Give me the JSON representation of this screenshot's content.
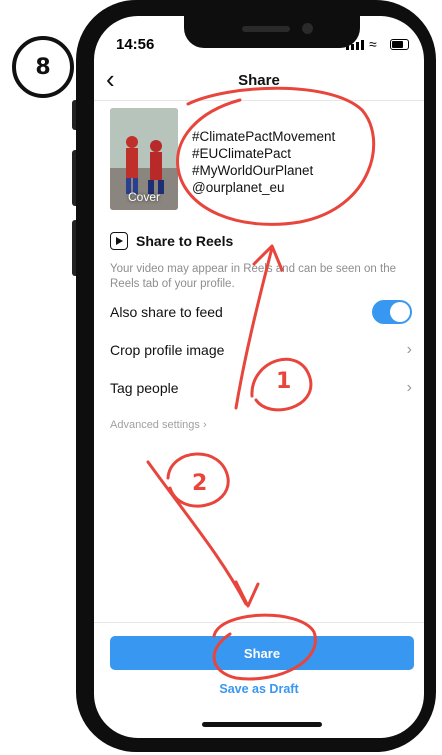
{
  "step": {
    "number": "8"
  },
  "status_bar": {
    "time": "14:56"
  },
  "nav": {
    "title": "Share",
    "back_icon": "chevron-left-icon"
  },
  "post": {
    "cover_label": "Cover",
    "caption_lines": [
      "#ClimatePactMovement",
      "#EUClimatePact",
      "#MyWorldOurPlanet",
      "@ourplanet_eu"
    ]
  },
  "reels": {
    "title": "Share to Reels",
    "description": "Your video may appear in Reels and can be seen on the Reels tab of your profile."
  },
  "settings": {
    "also_share_label": "Also share to feed",
    "also_share_enabled": true,
    "crop_label": "Crop profile image",
    "tag_label": "Tag people",
    "advanced_label": "Advanced settings"
  },
  "actions": {
    "share_label": "Share",
    "draft_label": "Save as Draft"
  },
  "annotations": {
    "marker_1": "1",
    "marker_2": "2",
    "color": "#e8453c"
  },
  "colors": {
    "accent": "#3897f0",
    "annotation": "#e8453c"
  }
}
